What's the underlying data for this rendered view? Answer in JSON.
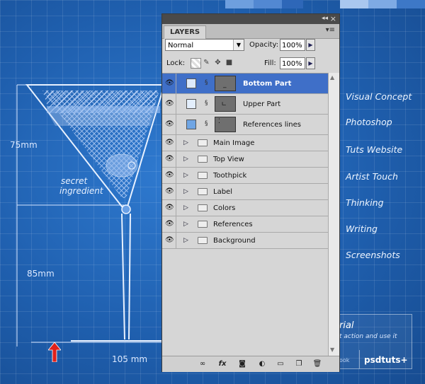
{
  "canvas": {
    "left_texts": {
      "dim_75": "75mm",
      "dim_85": "85mm",
      "dim_105": "105 mm",
      "secret_line1": "secret",
      "secret_line2": "ingredient"
    },
    "menu_items": [
      "Visual Concept",
      "Photoshop",
      "Tuts Website",
      "Artist Touch",
      "Thinking",
      "Writing",
      "Screenshots"
    ],
    "tutorial_box": {
      "title_fragment": "rial",
      "sub_fragment": "t action and use it",
      "small_fragment": "ook",
      "brand": "psdtuts+"
    },
    "colors": {
      "background": "#1f5fae",
      "grid": "#ffffff",
      "red_arrow": "#e0211a"
    }
  },
  "layers_panel": {
    "tab": "LAYERS",
    "blend_mode": "Normal",
    "opacity_label": "Opacity:",
    "opacity_value": "100%",
    "lock_label": "Lock:",
    "fill_label": "Fill:",
    "fill_value": "100%",
    "layers": [
      {
        "name": "Bottom Part",
        "type": "layer",
        "selected": true,
        "visible": true
      },
      {
        "name": "Upper Part",
        "type": "layer",
        "selected": false,
        "visible": true
      },
      {
        "name": "References lines",
        "type": "layer",
        "selected": false,
        "visible": true
      }
    ],
    "groups": [
      {
        "name": "Main Image",
        "visible": true
      },
      {
        "name": "Top View",
        "visible": true
      },
      {
        "name": "Toothpick",
        "visible": true
      },
      {
        "name": "Label",
        "visible": true
      },
      {
        "name": "Colors",
        "visible": true
      },
      {
        "name": "References",
        "visible": true
      },
      {
        "name": "Background",
        "visible": true
      }
    ],
    "bottom_icons": [
      "link-icon",
      "fx-icon",
      "mask-icon",
      "adjustment-icon",
      "group-icon",
      "new-layer-icon",
      "trash-icon"
    ],
    "selection_color": "#3f6fc8"
  }
}
